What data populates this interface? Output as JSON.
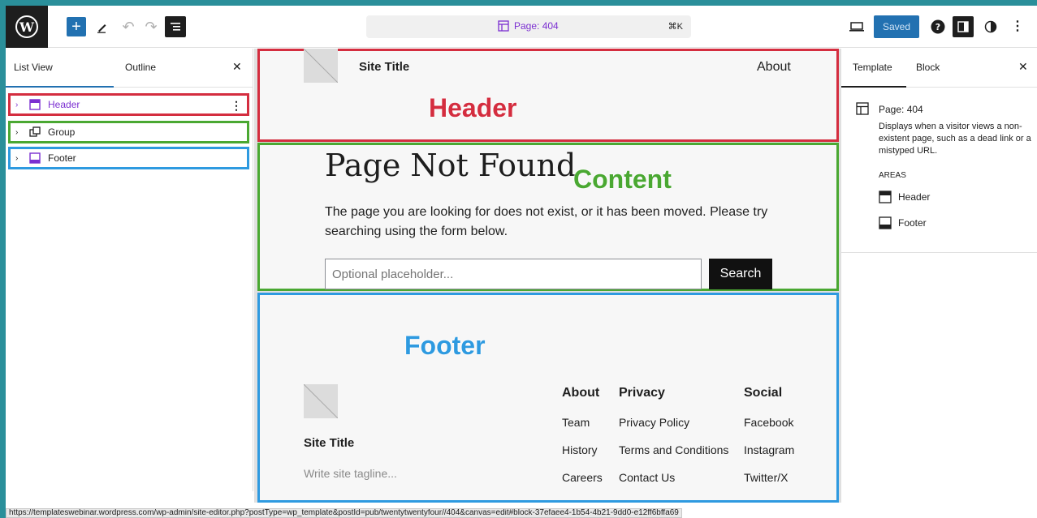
{
  "toolbar": {
    "document_title": "Page: 404",
    "shortcut": "⌘K",
    "saved_label": "Saved"
  },
  "left_panel": {
    "tabs": [
      {
        "label": "List View"
      },
      {
        "label": "Outline"
      }
    ],
    "items": [
      {
        "label": "Header",
        "color": "#7b2fd1"
      },
      {
        "label": "Group"
      },
      {
        "label": "Footer"
      }
    ]
  },
  "canvas": {
    "header": {
      "site_title": "Site Title",
      "nav_item": "About",
      "annotation": "Header"
    },
    "content": {
      "title": "Page Not Found",
      "annotation": "Content",
      "text": "The page you are looking for does not exist, or it has been moved. Please try searching using the form below.",
      "search_placeholder": "Optional placeholder...",
      "search_button": "Search"
    },
    "footer": {
      "annotation": "Footer",
      "site_title": "Site Title",
      "tagline": "Write site tagline...",
      "columns": [
        {
          "heading": "About",
          "links": [
            "Team",
            "History",
            "Careers"
          ]
        },
        {
          "heading": "Privacy",
          "links": [
            "Privacy Policy",
            "Terms and Conditions",
            "Contact Us"
          ]
        },
        {
          "heading": "Social",
          "links": [
            "Facebook",
            "Instagram",
            "Twitter/X"
          ]
        }
      ]
    }
  },
  "right_panel": {
    "tabs": [
      {
        "label": "Template"
      },
      {
        "label": "Block"
      }
    ],
    "template_title": "Page: 404",
    "description": "Displays when a visitor views a non-existent page, such as a dead link or a mistyped URL.",
    "areas_label": "AREAS",
    "areas": [
      {
        "label": "Header"
      },
      {
        "label": "Footer"
      }
    ]
  },
  "status_bar": {
    "url": "https://templateswebinar.wordpress.com/wp-admin/site-editor.php?postType=wp_template&postId=pub/twentytwentyfour//404&canvas=edit#block-37efaee4-1b54-4b21-9dd0-e12ff6bffa69"
  },
  "colors": {
    "header_outline": "#d42d3f",
    "content_outline": "#4aa832",
    "footer_outline": "#2e9ae0",
    "accent": "#2271b1"
  }
}
